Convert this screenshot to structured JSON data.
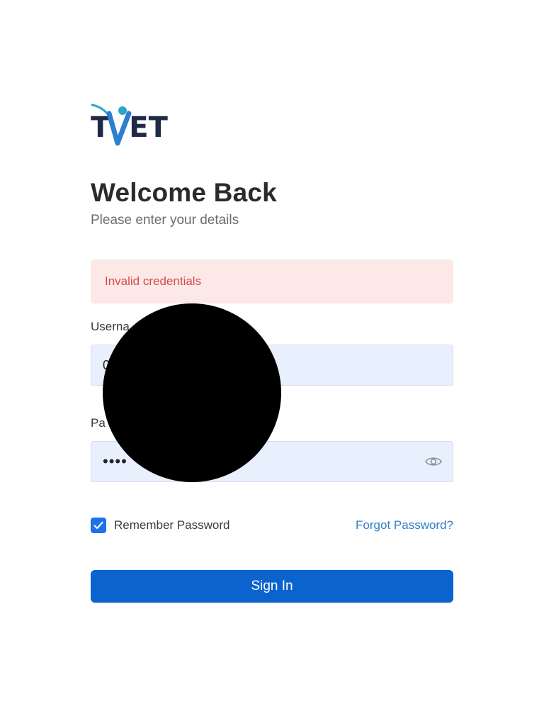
{
  "logo": {
    "text_left": "T",
    "text_right": "ET"
  },
  "header": {
    "title": "Welcome Back",
    "subtitle": "Please enter your details"
  },
  "alert": {
    "message": "Invalid credentials"
  },
  "form": {
    "username": {
      "label": "Userna",
      "value": "0"
    },
    "password": {
      "label": "Pa",
      "value": "••••"
    },
    "remember": {
      "label": "Remember Password",
      "checked": true
    },
    "forgot_label": "Forgot Password?",
    "submit_label": "Sign In"
  },
  "colors": {
    "primary": "#0b63ce",
    "alert_bg": "#fde8e8",
    "alert_text": "#d24b4b",
    "input_bg": "#e8f0fe",
    "link": "#2f7fc6",
    "logo_accent": "#2aa6c9"
  },
  "icons": {
    "password_toggle": "eye-icon",
    "checkbox": "check-icon"
  }
}
